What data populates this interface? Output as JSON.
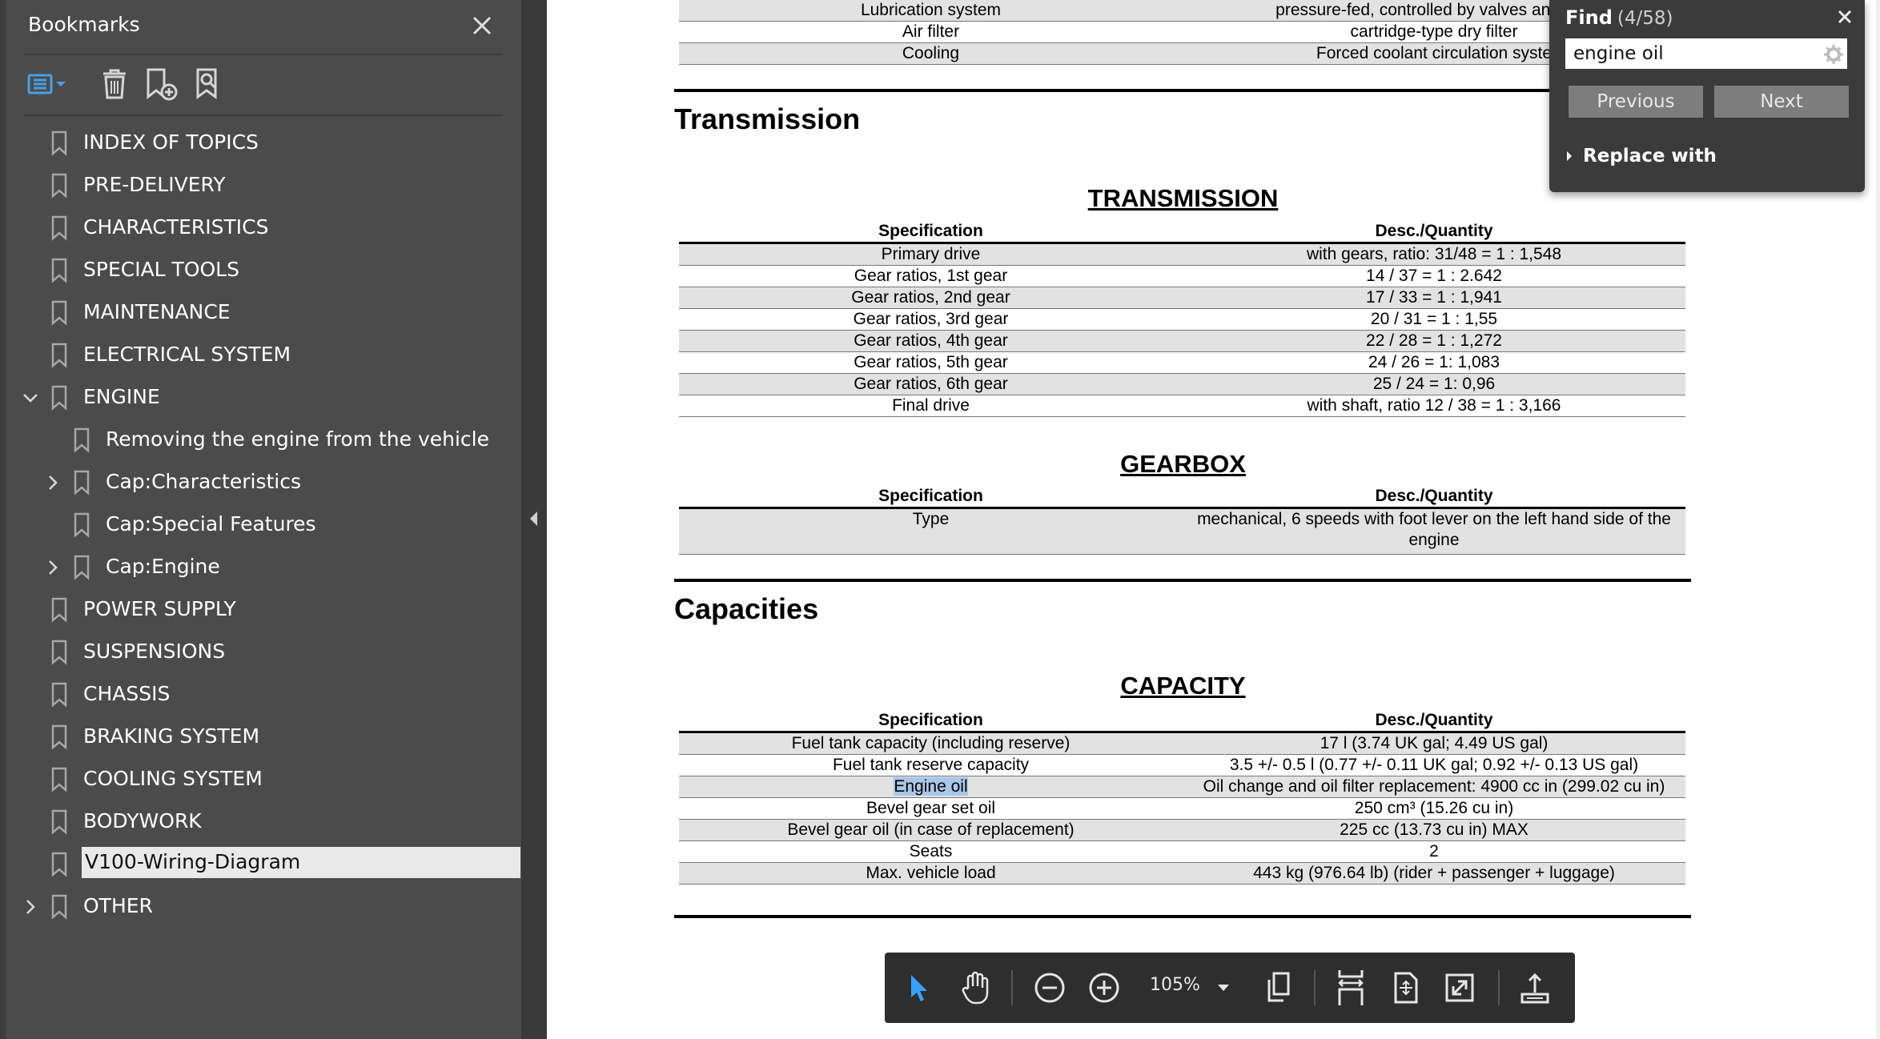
{
  "sidebar": {
    "title": "Bookmarks",
    "items": [
      {
        "label": "INDEX OF TOPICS",
        "level": 0,
        "expander": "none"
      },
      {
        "label": "PRE-DELIVERY",
        "level": 0,
        "expander": "none"
      },
      {
        "label": "CHARACTERISTICS",
        "level": 0,
        "expander": "none"
      },
      {
        "label": "SPECIAL TOOLS",
        "level": 0,
        "expander": "none"
      },
      {
        "label": "MAINTENANCE",
        "level": 0,
        "expander": "none"
      },
      {
        "label": "ELECTRICAL SYSTEM",
        "level": 0,
        "expander": "none"
      },
      {
        "label": "ENGINE",
        "level": 0,
        "expander": "expanded"
      },
      {
        "label": "Removing the engine from the vehicle",
        "level": 1,
        "expander": "none"
      },
      {
        "label": "Cap:Characteristics",
        "level": 1,
        "expander": "collapsed"
      },
      {
        "label": "Cap:Special Features",
        "level": 1,
        "expander": "none"
      },
      {
        "label": "Cap:Engine",
        "level": 1,
        "expander": "collapsed"
      },
      {
        "label": "POWER SUPPLY",
        "level": 0,
        "expander": "none"
      },
      {
        "label": "SUSPENSIONS",
        "level": 0,
        "expander": "none"
      },
      {
        "label": "CHASSIS",
        "level": 0,
        "expander": "none"
      },
      {
        "label": "BRAKING SYSTEM",
        "level": 0,
        "expander": "none"
      },
      {
        "label": "COOLING SYSTEM",
        "level": 0,
        "expander": "none"
      },
      {
        "label": "BODYWORK",
        "level": 0,
        "expander": "none"
      },
      {
        "label": "V100-Wiring-Diagram",
        "level": 0,
        "expander": "none",
        "selected": true
      },
      {
        "label": "OTHER",
        "level": 0,
        "expander": "collapsed"
      }
    ]
  },
  "doc": {
    "top_rows": [
      {
        "spec": "Lubrication system",
        "desc": "pressure-fed, controlled by valves and troc",
        "shade": true
      },
      {
        "spec": "Air filter",
        "desc": "cartridge-type dry filter",
        "shade": false
      },
      {
        "spec": "Cooling",
        "desc": "Forced coolant circulation syste",
        "shade": true
      }
    ],
    "section_transmission": "Transmission",
    "transmission_title": "TRANSMISSION",
    "col_spec": "Specification",
    "col_desc": "Desc./Quantity",
    "transmission_rows": [
      {
        "spec": "Primary drive",
        "desc": "with gears, ratio: 31/48 = 1 : 1,548",
        "shade": true
      },
      {
        "spec": "Gear ratios, 1st gear",
        "desc": "14 / 37 = 1 : 2.642",
        "shade": false
      },
      {
        "spec": "Gear ratios, 2nd gear",
        "desc": "17 / 33 = 1 : 1,941",
        "shade": true
      },
      {
        "spec": "Gear ratios, 3rd gear",
        "desc": "20 / 31 = 1 : 1,55",
        "shade": false
      },
      {
        "spec": "Gear ratios, 4th gear",
        "desc": "22 / 28 = 1 : 1,272",
        "shade": true
      },
      {
        "spec": "Gear ratios, 5th gear",
        "desc": "24 / 26 = 1: 1,083",
        "shade": false
      },
      {
        "spec": "Gear ratios, 6th gear",
        "desc": "25 / 24 = 1: 0,96",
        "shade": true
      },
      {
        "spec": "Final drive",
        "desc": "with shaft, ratio 12 / 38 = 1 : 3,166",
        "shade": false
      }
    ],
    "gearbox_title": "GEARBOX",
    "gearbox_rows": [
      {
        "spec": "Type",
        "desc": "mechanical, 6 speeds with foot lever on the left hand side of the engine",
        "shade": true
      }
    ],
    "section_capacities": "Capacities",
    "capacity_title": "CAPACITY",
    "capacity_rows": [
      {
        "spec": "Fuel tank capacity (including reserve)",
        "desc": "17 l (3.74 UK gal; 4.49 US gal)",
        "shade": true
      },
      {
        "spec": "Fuel tank reserve capacity",
        "desc": "3.5 +/- 0.5 l (0.77 +/- 0.11 UK gal; 0.92 +/- 0.13 US gal)",
        "shade": false
      },
      {
        "spec": "Engine oil",
        "desc": "Oil change and oil filter replacement: 4900 cc in (299.02 cu in)",
        "shade": true,
        "highlight": true
      },
      {
        "spec": "Bevel gear set oil",
        "desc": "250 cm³ (15.26 cu in)",
        "shade": false
      },
      {
        "spec": "Bevel gear oil (in case of replacement)",
        "desc": "225 cc (13.73 cu in) MAX",
        "shade": true
      },
      {
        "spec": "Seats",
        "desc": "2",
        "shade": false
      },
      {
        "spec": "Max. vehicle load",
        "desc": "443 kg (976.64 lb) (rider + passenger + luggage)",
        "shade": true
      }
    ]
  },
  "find": {
    "title": "Find",
    "count": "(4/58)",
    "query": "engine oil",
    "previous_label": "Previous",
    "next_label": "Next",
    "replace_label": "Replace with"
  },
  "toolbar": {
    "zoom": "105%"
  },
  "colors": {
    "sidebar_bg": "#4b4b4b",
    "select_accent": "#3aa0ff",
    "bookmark_icon_accent": "#4a9fe8",
    "search_highlight": "#a9c7e8"
  }
}
